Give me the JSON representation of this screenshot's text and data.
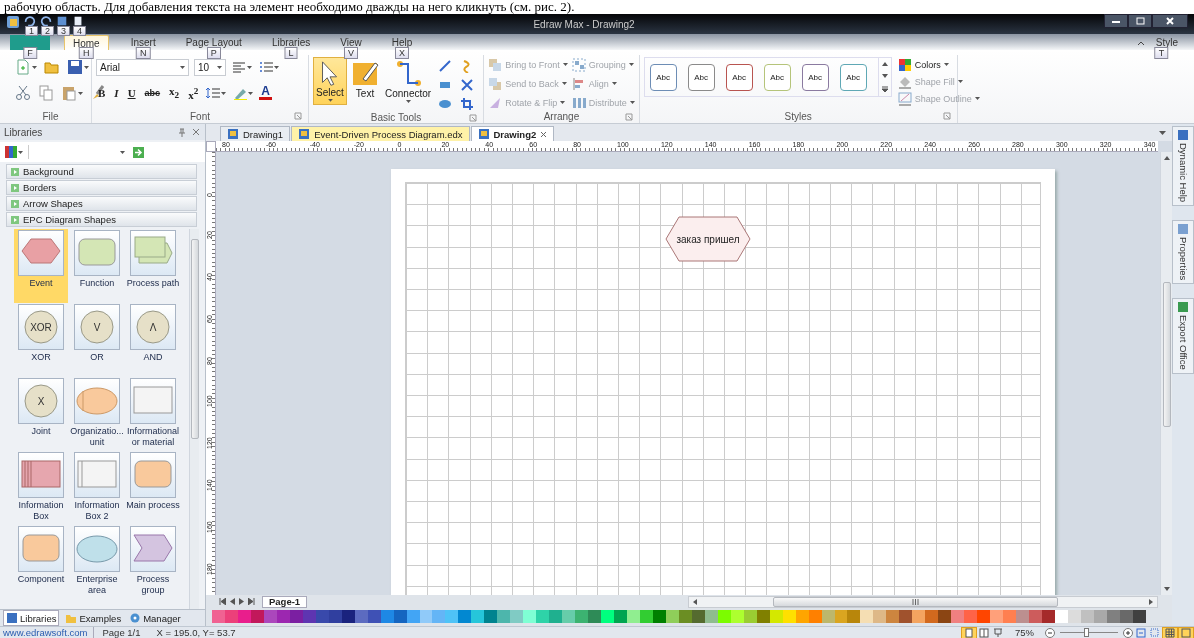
{
  "caption": "рабочую область. Для добавления текста на элемент необходимо дважды на него кликнуть (см. рис. 2).",
  "window": {
    "title": "Edraw Max - Drawing2",
    "quick_access_keytips": [
      "1",
      "2",
      "3",
      "4"
    ]
  },
  "ribbon_tabs": [
    {
      "kind": "file",
      "keytip": "F",
      "selected": false
    },
    {
      "label": "Home",
      "kind": "tab",
      "keytip": "H",
      "selected": true
    },
    {
      "label": "Insert",
      "kind": "tab",
      "keytip": "N",
      "selected": false
    },
    {
      "label": "Page Layout",
      "kind": "tab",
      "keytip": "P",
      "selected": false
    },
    {
      "label": "Libraries",
      "kind": "tab",
      "keytip": "L",
      "selected": false
    },
    {
      "label": "View",
      "kind": "tab",
      "keytip": "V",
      "selected": false
    },
    {
      "label": "Help",
      "kind": "tab",
      "keytip": "X",
      "selected": false
    }
  ],
  "style_menu": {
    "label": "Style",
    "keytip": "T"
  },
  "ribbon_groups": [
    {
      "kind": "file",
      "label": "File"
    },
    {
      "kind": "font",
      "label": "Font",
      "font_name": "Arial",
      "font_size": "10",
      "format_buttons": [
        "B",
        "I",
        "U",
        "abc",
        "x$_{2}$",
        "x$^{2}$"
      ],
      "font_color_glyph": "A"
    },
    {
      "kind": "tools",
      "label": "Basic Tools",
      "tools": [
        {
          "label": "Select",
          "selected": true
        },
        {
          "label": "Text",
          "selected": false
        },
        {
          "label": "Connector",
          "selected": false
        }
      ]
    },
    {
      "kind": "arrange",
      "label": "Arrange",
      "commands": [
        {
          "label": "Bring to Front",
          "disabled": true
        },
        {
          "label": "Grouping",
          "disabled": true
        },
        {
          "label": "Send to Back",
          "disabled": true
        },
        {
          "label": "Align",
          "disabled": true
        },
        {
          "label": "Rotate & Flip",
          "disabled": true
        },
        {
          "label": "Distribute",
          "disabled": true
        }
      ]
    },
    {
      "kind": "styles",
      "label": "Styles",
      "swatches": [
        {
          "label": "Abc",
          "color": "#6d8db5"
        },
        {
          "label": "Abc",
          "color": "#8a8a8a"
        },
        {
          "label": "Abc",
          "color": "#b85450"
        },
        {
          "label": "Abc",
          "color": "#b5c47a"
        },
        {
          "label": "Abc",
          "color": "#8a7aa0"
        },
        {
          "label": "Abc",
          "color": "#5fa8b5"
        }
      ],
      "commands": [
        {
          "label": "Colors",
          "disabled": false
        },
        {
          "label": "Shape Fill",
          "disabled": true
        },
        {
          "label": "Shape Outline",
          "disabled": true
        }
      ]
    }
  ],
  "libraries": {
    "title": "Libraries",
    "categories": [
      "Background",
      "Borders",
      "Arrow Shapes",
      "EPC Diagram Shapes"
    ],
    "shapes": [
      {
        "label": "Event",
        "kind": "hexagon",
        "color": "#e8a0a4",
        "selected": true
      },
      {
        "label": "Function",
        "kind": "rounded",
        "color": "#d4e6b5",
        "selected": false
      },
      {
        "label": "Process path",
        "kind": "path",
        "color": "#d4e6b5",
        "selected": false
      },
      {
        "label": "XOR",
        "kind": "circle",
        "color": "#e6e0c8",
        "selected": false
      },
      {
        "label": "OR",
        "kind": "circle",
        "color": "#e6e0c8",
        "selected": false
      },
      {
        "label": "AND",
        "kind": "circle",
        "color": "#e6e0c8",
        "selected": false
      },
      {
        "label": "Joint",
        "kind": "circle",
        "color": "#e6e0c8",
        "selected": false
      },
      {
        "label": "Organizatio...\nunit",
        "kind": "ellipsebar",
        "color": "#f9c99c",
        "selected": false
      },
      {
        "label": "Informational\nor material",
        "kind": "rect",
        "color": "#f4f4f4",
        "selected": false
      },
      {
        "label": "Information\nBox",
        "kind": "striped",
        "color": "#e6a6ae",
        "selected": false
      },
      {
        "label": "Information\nBox 2",
        "kind": "bar",
        "color": "#f4f4f4",
        "selected": false
      },
      {
        "label": "Main process",
        "kind": "rounded",
        "color": "#f9c99c",
        "selected": false
      },
      {
        "label": "Component",
        "kind": "rounded",
        "color": "#f9c99c",
        "selected": false
      },
      {
        "label": "Enterprise\narea",
        "kind": "ellipse",
        "color": "#bfe0ea",
        "selected": false
      },
      {
        "label": "Process\ngroup",
        "kind": "chevron",
        "color": "#d4c4e0",
        "selected": false
      }
    ],
    "shape_glyphs": [
      "XOR",
      "V",
      "Λ",
      "X"
    ],
    "tabs": [
      {
        "label": "Libraries",
        "selected": true
      },
      {
        "label": "Examples",
        "selected": false
      },
      {
        "label": "Manager",
        "selected": false
      }
    ]
  },
  "document_tabs": [
    {
      "label": "Drawing1",
      "selected": false,
      "highlighted": false
    },
    {
      "label": "Event-Driven Process Diagram.edx",
      "selected": false,
      "highlighted": true
    },
    {
      "label": "Drawing2",
      "selected": true,
      "highlighted": false
    }
  ],
  "ruler": {
    "horizontal": [
      "80",
      "-60",
      "-40",
      "-20",
      "0",
      "20",
      "40",
      "60",
      "80",
      "100",
      "120",
      "140",
      "160",
      "180",
      "200",
      "220",
      "240",
      "260",
      "280",
      "300",
      "320",
      "340"
    ],
    "vertical": [
      "0",
      "20",
      "40",
      "60",
      "80",
      "100",
      "120",
      "140",
      "160",
      "180"
    ]
  },
  "canvas": {
    "shapes": [
      {
        "kind": "event",
        "text": "заказ пришел"
      }
    ]
  },
  "page_tabs": [
    {
      "label": "Page-1",
      "selected": true
    }
  ],
  "palette": [
    {
      "color": "#f06292"
    },
    {
      "color": "#ec407a"
    },
    {
      "color": "#e91e8c"
    },
    {
      "color": "#c2185b"
    },
    {
      "color": "#ab47bc"
    },
    {
      "color": "#9c27b0"
    },
    {
      "color": "#7b1fa2"
    },
    {
      "color": "#5e35b1"
    },
    {
      "color": "#3949ab"
    },
    {
      "color": "#303f9f"
    },
    {
      "color": "#1a237e"
    },
    {
      "color": "#5c6bc0"
    },
    {
      "color": "#3f51b5"
    },
    {
      "color": "#1e88e5"
    },
    {
      "color": "#1565c0"
    },
    {
      "color": "#42a5f5"
    },
    {
      "color": "#90caf9"
    },
    {
      "color": "#64b5f6"
    },
    {
      "color": "#4fc3f7"
    },
    {
      "color": "#0288d1"
    },
    {
      "color": "#26c6da"
    },
    {
      "color": "#00838f"
    },
    {
      "color": "#4db6ac"
    },
    {
      "color": "#80cbc4"
    },
    {
      "color": "#7fffd4"
    },
    {
      "color": "#2ed3a8"
    },
    {
      "color": "#1fb08f"
    },
    {
      "color": "#66cdaa"
    },
    {
      "color": "#3cb371"
    },
    {
      "color": "#2e8b57"
    },
    {
      "color": "#00ff7f"
    },
    {
      "color": "#00a550"
    },
    {
      "color": "#90ee90"
    },
    {
      "color": "#32cd32"
    },
    {
      "color": "#008000"
    },
    {
      "color": "#8fce5a"
    },
    {
      "color": "#6b8e23"
    },
    {
      "color": "#556b2f"
    },
    {
      "color": "#8fbc8f"
    },
    {
      "color": "#7cfc00"
    },
    {
      "color": "#adff2f"
    },
    {
      "color": "#9acd32"
    },
    {
      "color": "#808000"
    },
    {
      "color": "#d4e800"
    },
    {
      "color": "#ffe000"
    },
    {
      "color": "#ffa500"
    },
    {
      "color": "#ff8000"
    },
    {
      "color": "#bdb76b"
    },
    {
      "color": "#daa520"
    },
    {
      "color": "#b8860b"
    },
    {
      "color": "#f5deb3"
    },
    {
      "color": "#deb887"
    },
    {
      "color": "#cd853f"
    },
    {
      "color": "#a0522d"
    },
    {
      "color": "#f4a460"
    },
    {
      "color": "#d2691e"
    },
    {
      "color": "#8b4513"
    },
    {
      "color": "#f08080"
    },
    {
      "color": "#ff6347"
    },
    {
      "color": "#ff4500"
    },
    {
      "color": "#ffa07a"
    },
    {
      "color": "#ff7f50"
    },
    {
      "color": "#bc8f8f"
    },
    {
      "color": "#cd5c5c"
    },
    {
      "color": "#a52a2a"
    },
    {
      "color": "#ffffff"
    },
    {
      "color": "#dcdcdc"
    },
    {
      "color": "#c0c0c0"
    },
    {
      "color": "#a9a9a9"
    },
    {
      "color": "#808080"
    },
    {
      "color": "#696969"
    },
    {
      "color": "#404040"
    }
  ],
  "side_tabs": [
    "Dynamic Help",
    "Properties",
    "Export Office"
  ],
  "status_bar": {
    "link": "www.edrawsoft.com",
    "page": "Page 1/1",
    "coords": "X = 195.0, Y= 53.7",
    "zoom": "75%",
    "view_modes": [
      {
        "selected": true
      },
      {
        "selected": false
      },
      {
        "selected": false
      }
    ],
    "zoom_slider": {
      "level": 0.45
    },
    "toggles": [
      {
        "selected": false
      },
      {
        "selected": false
      },
      {
        "selected": true
      },
      {
        "selected": true
      }
    ]
  }
}
